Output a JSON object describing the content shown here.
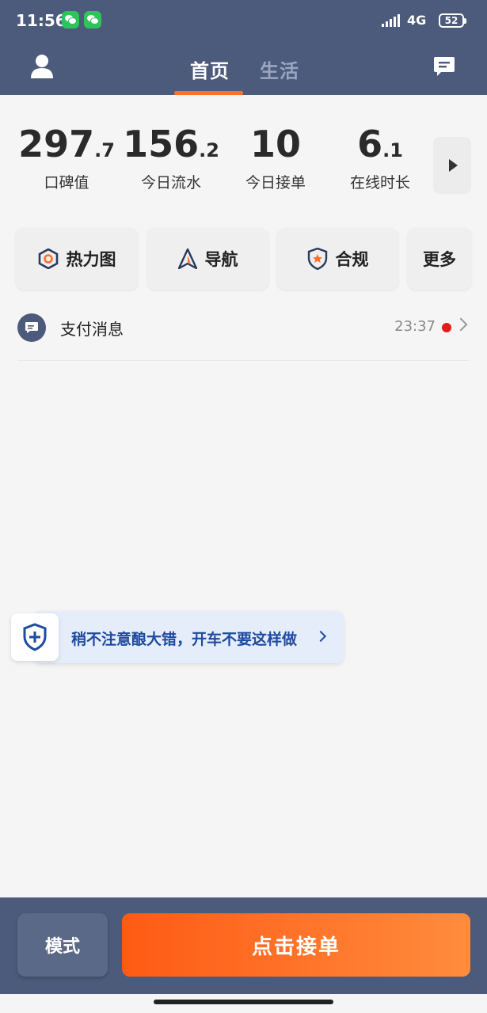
{
  "status_bar": {
    "time": "11:56",
    "network": "4G",
    "battery": "52",
    "notification_icons": [
      "wechat-icon",
      "wechat-icon"
    ]
  },
  "header": {
    "tabs": [
      {
        "label": "首页",
        "active": true
      },
      {
        "label": "生活",
        "active": false
      }
    ],
    "left_icon": "profile-icon",
    "right_icon": "message-icon"
  },
  "stats": [
    {
      "big": "297",
      "small": ".7",
      "label": "口碑值"
    },
    {
      "big": "156",
      "small": ".2",
      "label": "今日流水"
    },
    {
      "big": "10",
      "small": "",
      "label": "今日接单"
    },
    {
      "big": "6",
      "small": ".1",
      "label": "在线时长"
    }
  ],
  "actions": [
    {
      "label": "热力图",
      "icon": "heatmap-icon"
    },
    {
      "label": "导航",
      "icon": "navigation-icon"
    },
    {
      "label": "合规",
      "icon": "compliance-shield-icon"
    },
    {
      "label": "更多",
      "icon": ""
    }
  ],
  "message": {
    "title": "支付消息",
    "time": "23:37"
  },
  "safety_tip": {
    "text": "稍不注意酿大错，开车不要这样做"
  },
  "bottom": {
    "mode_label": "模式",
    "accept_label": "点击接单"
  },
  "colors": {
    "header_bg": "#4c5a7c",
    "accent": "#ff6f2c",
    "tip_text": "#1e4aa0"
  }
}
